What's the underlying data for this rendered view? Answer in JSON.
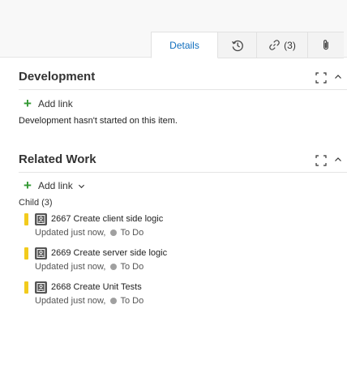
{
  "tabs": {
    "details_label": "Details",
    "links_count": "(3)"
  },
  "development": {
    "title": "Development",
    "add_link_label": "Add link",
    "empty_message": "Development hasn't started on this item."
  },
  "related_work": {
    "title": "Related Work",
    "add_link_label": "Add link",
    "child_group_label": "Child (3)",
    "items": [
      {
        "id": "2667",
        "title": "Create client side logic",
        "updated": "Updated just now,",
        "state": "To Do"
      },
      {
        "id": "2669",
        "title": "Create server side logic",
        "updated": "Updated just now,",
        "state": "To Do"
      },
      {
        "id": "2668",
        "title": "Create Unit Tests",
        "updated": "Updated just now,",
        "state": "To Do"
      }
    ]
  },
  "colors": {
    "accent": "#106ebe",
    "add_green": "#339933",
    "task_yellow": "#f2cb1d",
    "state_todo_gray": "#a0a0a0"
  },
  "icons": {
    "history": "history-icon",
    "link": "link-icon",
    "attachment": "paperclip-icon",
    "expand": "expand-icon",
    "collapse": "chevron-up-icon",
    "add": "plus-icon",
    "dropdown": "chevron-down-icon",
    "work_item": "task-icon"
  }
}
